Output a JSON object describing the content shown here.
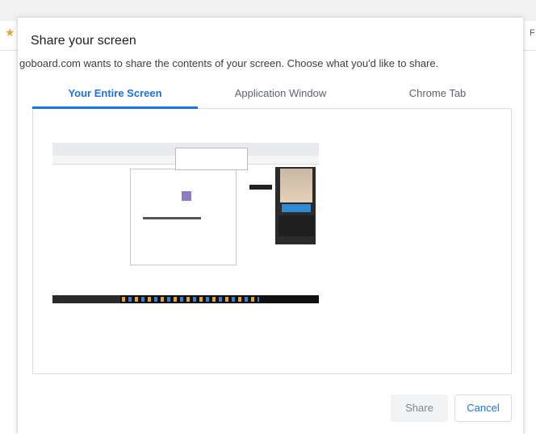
{
  "dialog": {
    "title": "Share your screen",
    "description": "goboard.com wants to share the contents of your screen. Choose what you'd like to share.",
    "tabs": [
      {
        "label": "Your Entire Screen",
        "selected": true
      },
      {
        "label": "Application Window",
        "selected": false
      },
      {
        "label": "Chrome Tab",
        "selected": false
      }
    ],
    "share_label": "Share",
    "cancel_label": "Cancel"
  },
  "background": {
    "right_edge_text": "F"
  },
  "colors": {
    "accent": "#1a73e8",
    "disabled_text": "#80868b",
    "border": "#dadce0"
  }
}
